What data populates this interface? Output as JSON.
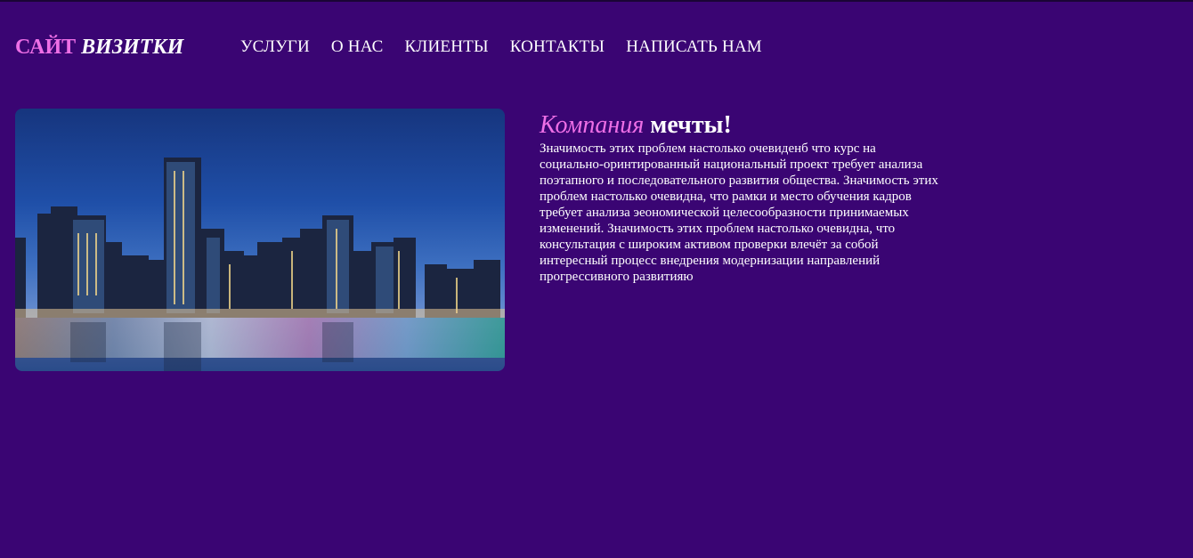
{
  "header": {
    "logo_part1": "САЙТ",
    "logo_part2": "ВИЗИТКИ"
  },
  "nav": [
    {
      "label": "УСЛУГИ"
    },
    {
      "label": "О НАС"
    },
    {
      "label": "КЛИЕНТЫ"
    },
    {
      "label": "КОНТАКТЫ"
    },
    {
      "label": "НАПИСАТЬ НАМ"
    }
  ],
  "hero": {
    "image": "city-skyline-night-photo"
  },
  "main": {
    "title_accent": "Компания",
    "title_rest": "мечты!",
    "text": "Значимость этих проблем настолько очевиденб что курс на социально-оринтированный национальный проект требует анализа поэтапного и последовательного развития общества. Значимость этих проблем настолько очевидна, что рамки и место обучения кадров требует анализа эеономической целесообразности принимаемых изменений. Значимость этих проблем настолько очевидна, что консультация с широким активом проверки влечёт за собой интересный процесс внедрения модернизации направлений прогрессивного развитияю"
  },
  "colors": {
    "background": "#3a0573",
    "accent": "#ee6fe6",
    "text": "#ffffff"
  }
}
